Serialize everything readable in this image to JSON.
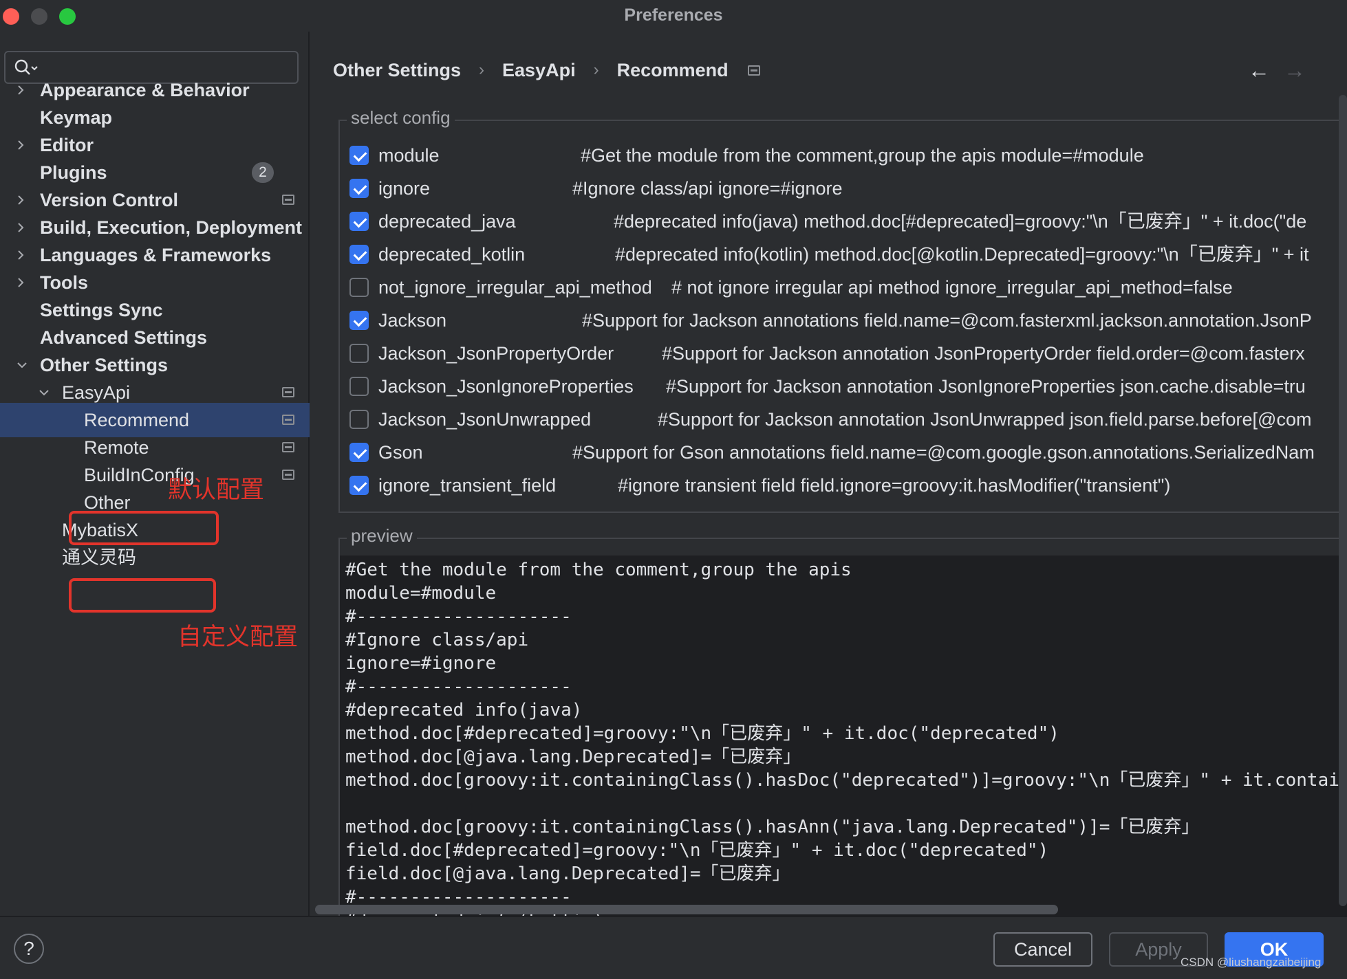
{
  "window": {
    "title": "Preferences"
  },
  "search": {
    "placeholder": "",
    "value": ""
  },
  "sidebar": {
    "items": [
      {
        "label": "Appearance & Behavior"
      },
      {
        "label": "Keymap"
      },
      {
        "label": "Editor"
      },
      {
        "label": "Plugins",
        "badge": "2"
      },
      {
        "label": "Version Control"
      },
      {
        "label": "Build, Execution, Deployment"
      },
      {
        "label": "Languages & Frameworks"
      },
      {
        "label": "Tools"
      },
      {
        "label": "Settings Sync"
      },
      {
        "label": "Advanced Settings"
      },
      {
        "label": "Other Settings"
      },
      {
        "label": "EasyApi"
      },
      {
        "label": "Recommend"
      },
      {
        "label": "Remote"
      },
      {
        "label": "BuildInConfig"
      },
      {
        "label": "Other"
      },
      {
        "label": "MybatisX"
      },
      {
        "label": "通义灵码"
      }
    ],
    "selected": "Recommend"
  },
  "annotations": {
    "default_config": "默认配置",
    "custom_config": "自定义配置"
  },
  "breadcrumb": [
    "Other Settings",
    "EasyApi",
    "Recommend"
  ],
  "select_config": {
    "title": "select config",
    "rows": [
      {
        "name": "module",
        "checked": true,
        "desc": "#Get the module from the comment,group the apis    module=#module"
      },
      {
        "name": "ignore",
        "checked": true,
        "desc": "#Ignore class/api    ignore=#ignore"
      },
      {
        "name": "deprecated_java",
        "checked": true,
        "desc": "#deprecated info(java)    method.doc[#deprecated]=groovy:\"\\n「已废弃」\" + it.doc(\"de"
      },
      {
        "name": "deprecated_kotlin",
        "checked": true,
        "desc": "#deprecated info(kotlin)    method.doc[@kotlin.Deprecated]=groovy:\"\\n「已废弃」\" + it"
      },
      {
        "name": "not_ignore_irregular_api_method",
        "checked": false,
        "desc": "# not ignore irregular api method    ignore_irregular_api_method=false"
      },
      {
        "name": "Jackson",
        "checked": true,
        "desc": "#Support for Jackson annotations    field.name=@com.fasterxml.jackson.annotation.JsonP"
      },
      {
        "name": "Jackson_JsonPropertyOrder",
        "checked": false,
        "desc": "#Support for Jackson annotation JsonPropertyOrder    field.order=@com.fasterx"
      },
      {
        "name": "Jackson_JsonIgnoreProperties",
        "checked": false,
        "desc": "#Support for Jackson annotation JsonIgnoreProperties    json.cache.disable=tru"
      },
      {
        "name": "Jackson_JsonUnwrapped",
        "checked": false,
        "desc": "#Support for Jackson annotation JsonUnwrapped    json.field.parse.before[@com"
      },
      {
        "name": "Gson",
        "checked": true,
        "desc": "#Support for Gson annotations    field.name=@com.google.gson.annotations.SerializedNam"
      },
      {
        "name": "ignore_transient_field",
        "checked": true,
        "desc": "#ignore transient field    field.ignore=groovy:it.hasModifier(\"transient\")"
      }
    ]
  },
  "preview": {
    "title": "preview",
    "lines": [
      "#Get the module from the comment,group the apis",
      "module=#module",
      "#--------------------",
      "#Ignore class/api",
      "ignore=#ignore",
      "#--------------------",
      "#deprecated info(java)",
      "method.doc[#deprecated]=groovy:\"\\n「已废弃」\" + it.doc(\"deprecated\")",
      "method.doc[@java.lang.Deprecated]=「已废弃」",
      "method.doc[groovy:it.containingClass().hasDoc(\"deprecated\")]=groovy:\"\\n「已废弃」\" + it.contain",
      "",
      "method.doc[groovy:it.containingClass().hasAnn(\"java.lang.Deprecated\")]=「已废弃」",
      "field.doc[#deprecated]=groovy:\"\\n「已废弃」\" + it.doc(\"deprecated\")",
      "field.doc[@java.lang.Deprecated]=「已废弃」",
      "#--------------------",
      "#deprecated info(kotlin)"
    ]
  },
  "footer": {
    "help": "?",
    "cancel": "Cancel",
    "apply": "Apply",
    "ok": "OK"
  },
  "watermark": "CSDN @liushangzaibeijing",
  "colors": {
    "accent": "#3574f0",
    "selection": "#2e436e",
    "annotation": "#e2342b",
    "background": "#2b2d30"
  }
}
